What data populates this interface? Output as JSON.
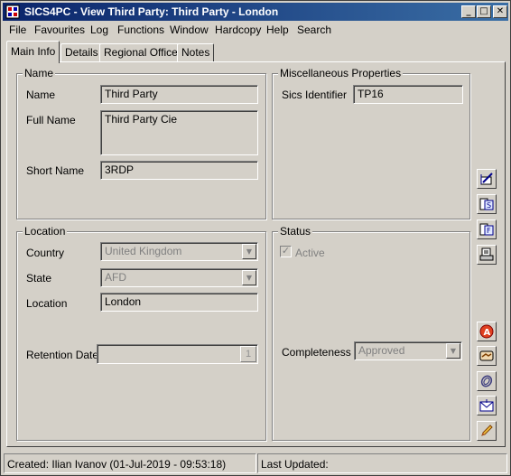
{
  "window": {
    "title": "SICS4PC - View Third Party: Third Party - London",
    "minimize": "_",
    "maximize": "□",
    "close": "✕"
  },
  "menu": [
    "File",
    "Favourites",
    "Log",
    "Functions",
    "Window",
    "Hardcopy",
    "Help",
    "Search"
  ],
  "tabs": [
    "Main Info",
    "Details",
    "Regional Office",
    "Notes"
  ],
  "active_tab": "Main Info",
  "name_group": {
    "title": "Name",
    "name_label": "Name",
    "name_value": "Third Party",
    "full_name_label": "Full Name",
    "full_name_value": "Third Party Cie",
    "short_name_label": "Short Name",
    "short_name_value": "3RDP"
  },
  "misc_group": {
    "title": "Miscellaneous Properties",
    "sics_label": "Sics Identifier",
    "sics_value": "TP16"
  },
  "location_group": {
    "title": "Location",
    "country_label": "Country",
    "country_value": "United Kingdom",
    "state_label": "State",
    "state_value": "AFD",
    "location_label": "Location",
    "location_value": "London",
    "retention_label": "Retention Date",
    "retention_value": ""
  },
  "status_group": {
    "title": "Status",
    "active_label": "Active",
    "active_checked": true,
    "completeness_label": "Completeness",
    "completeness_value": "Approved"
  },
  "side_buttons": [
    "edit-icon",
    "s-document-icon",
    "f-document-icon",
    "print-icon",
    "a-circle-icon",
    "handshake-icon",
    "paperclip-icon",
    "envelope-icon",
    "pencil-icon"
  ],
  "statusbar": {
    "created": "Created: Ilian Ivanov (01-Jul-2019 - 09:53:18)",
    "updated": "Last Updated:"
  }
}
